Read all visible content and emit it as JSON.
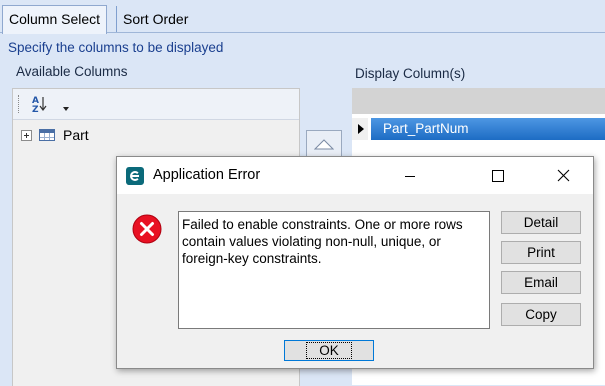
{
  "tabs": [
    {
      "label": "Column Select",
      "active": true
    },
    {
      "label": "Sort Order",
      "active": false
    }
  ],
  "hint": "Specify the columns to be displayed",
  "available": {
    "label": "Available Columns",
    "sort_icon": "sort-az-icon",
    "tree_items": [
      {
        "label": "Part"
      }
    ]
  },
  "display": {
    "label": "Display Column(s)",
    "rows": [
      {
        "label": "Part_PartNum",
        "selected": true
      }
    ]
  },
  "dialog": {
    "title": "Application Error",
    "message": "Failed to enable constraints. One or more rows contain values violating non-null, unique, or foreign-key constraints.",
    "buttons": [
      "Detail",
      "Print",
      "Email",
      "Copy"
    ],
    "ok_label": "OK"
  },
  "colors": {
    "accent": "#2a7fd6",
    "error": "#e81123",
    "background": "#dbe6f6"
  }
}
